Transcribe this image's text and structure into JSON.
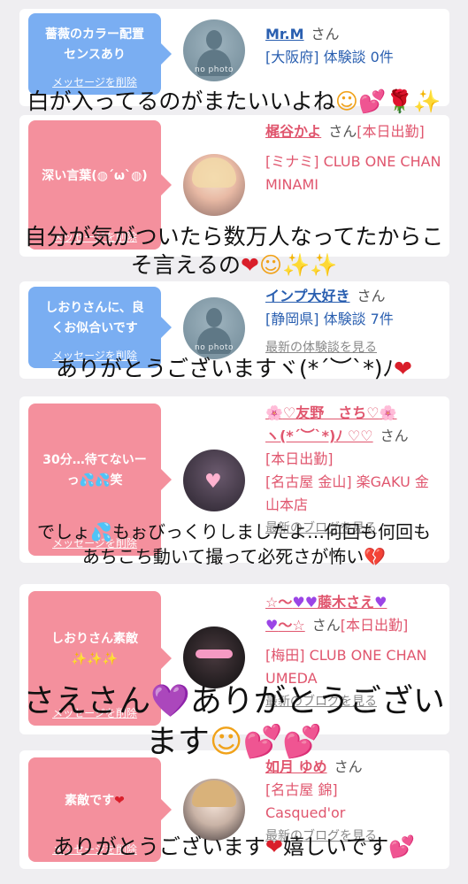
{
  "common": {
    "delete_label": "メッセージを削除",
    "san": "さん",
    "no_photo": "no photo",
    "blog_link": "最新のブログを見る",
    "experience_link": "最新の体験談を見る"
  },
  "cards": [
    {
      "message": "薔薇のカラー配置センスあり",
      "username": "Mr.M",
      "suffix": "",
      "location_line": "[大阪府] 体験談 0件",
      "overlay": "白が入ってるのがまたいいよね"
    },
    {
      "message": "深い言葉(◍´ω`◍)",
      "username": "梶谷かよ",
      "suffix": "[本日出勤]",
      "location_line": "[ミナミ] CLUB ONE CHAN MINAMI",
      "overlay_line1": "自分が気がついたら数万人なってたからこ",
      "overlay_line2": "そ言えるの"
    },
    {
      "message": "しおりさんに、良くお似合いです",
      "username": "インプ大好き",
      "suffix": "",
      "location_line": "[静岡県] 体験談 7件",
      "overlay": "ありがとうございますヾ(*´︶`*)ﾉ"
    },
    {
      "message": "30分…待てないーっ",
      "message_tail": "笑",
      "username": "♡友野　さち♡",
      "username_line2": "ヽ(*´︶`*)ﾉ ♡♡",
      "suffix": "",
      "status": "[本日出勤]",
      "location_line": "[名古屋 金山] 楽GAKU 金山本店",
      "overlay_line1": "でしょ",
      "overlay_line1b": "もぉびっくりしましたよ…何回も何回も",
      "overlay_line2": "あちこち動いて撮って必死さが怖い"
    },
    {
      "message": "しおりさん素敵",
      "username": "☆〜",
      "username_mid": "藤木さえ",
      "username_tail": "〜☆",
      "suffix": "[本日出勤]",
      "location_line": "[梅田] CLUB ONE CHAN UMEDA",
      "overlay_line1": "さえさん",
      "overlay_line1b": "ありがとうござい",
      "overlay_line2": "ます"
    },
    {
      "message": "素敵です",
      "username": "如月 ゆめ",
      "suffix": "",
      "location_line": "[名古屋 錦] Casqued'or",
      "overlay_line1": "ありがとうございます",
      "overlay_line1b": "嬉しいです"
    }
  ]
}
